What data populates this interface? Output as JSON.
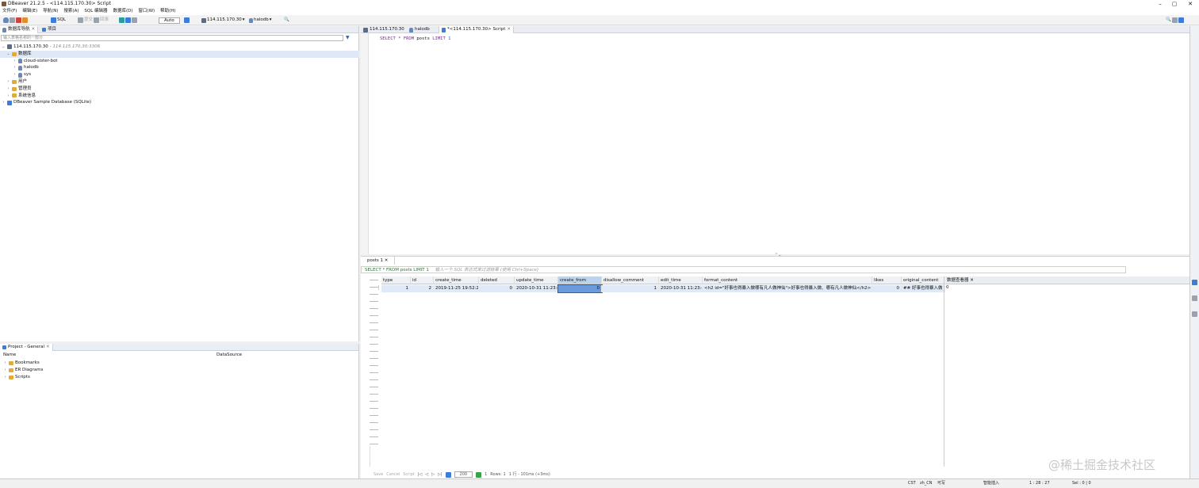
{
  "window": {
    "title": "DBeaver 21.2.5 - <114.115.170.30> Script"
  },
  "menu": [
    "文件(F)",
    "编辑(E)",
    "导航(N)",
    "搜索(A)",
    "SQL 编辑器",
    "数据库(D)",
    "窗口(W)",
    "帮助(H)"
  ],
  "toolbar": {
    "sql_label": "SQL",
    "commit_label": "提交",
    "rollback_label": "回滚",
    "autocommit": "Auto",
    "connection": "114.115.170.30",
    "database": "halodb"
  },
  "navigator": {
    "tabs": [
      "数据库导航",
      "项目"
    ],
    "filter_placeholder": "输入表格名称的一部分",
    "tree": [
      {
        "label": "114.115.170.30",
        "note": "- 114.115.170.30:3306"
      },
      {
        "label": "数据库"
      },
      {
        "label": "cloud-sister-bot"
      },
      {
        "label": "halodb"
      },
      {
        "label": "sys"
      },
      {
        "label": "用户"
      },
      {
        "label": "管理员"
      },
      {
        "label": "系统信息"
      },
      {
        "label": "DBeaver Sample Database (SQLite)"
      }
    ]
  },
  "project": {
    "title": "Project - General",
    "columns": [
      "Name",
      "DataSource"
    ],
    "items": [
      "Bookmarks",
      "ER Diagrams",
      "Scripts"
    ]
  },
  "editor": {
    "tabs": [
      "114.115.170.30",
      "halodb",
      "*<114.115.170.30> Script"
    ],
    "sql": {
      "kw1": "SELECT",
      "star": "*",
      "kw2": "FROM",
      "table": "posts",
      "kw3": "LIMIT",
      "num": "1"
    }
  },
  "results": {
    "tab": "posts 1",
    "query": "SELECT * FROM posts LIMIT 1",
    "filter_placeholder": "输入一个 SQL 表达式来过滤结果 (使用 Ctrl+Space)",
    "columns": [
      "type",
      "id",
      "create_time",
      "deleted",
      "update_time",
      "create_from",
      "disallow_comment",
      "edit_time",
      "format_content",
      "likes",
      "original_content"
    ],
    "row": {
      "num": "1",
      "type": "1",
      "id": "2",
      "create_time": "2019-11-25 19:52:29",
      "deleted": "0",
      "update_time": "2020-10-31 11:23:40",
      "create_from": "0",
      "disallow_comment": "1",
      "edit_time": "2020-10-31 11:23:40",
      "format_content": "<h2 id=\"好事也得暴入做哪有凡人做神仙\">好事也得暴入做、哪有凡人做神仙</h2><h4",
      "likes": "0",
      "original_content": "## 好事也得暴入做"
    },
    "value_panel_title": "数据查看器",
    "value_panel_value": "0",
    "bottom": {
      "save": "Save",
      "cancel": "Cancel",
      "script": "Script",
      "page_size": "200",
      "count": "1",
      "rows": "Rows: 1",
      "timing": "1 行 - 101ms (+3ms)"
    }
  },
  "status": {
    "tz": "CST",
    "locale": "zh_CN",
    "writable": "可写",
    "insert": "智能插入",
    "position": "1 : 28 : 27",
    "sel": "Sel : 0 | 0"
  },
  "watermark": "@稀土掘金技术社区"
}
